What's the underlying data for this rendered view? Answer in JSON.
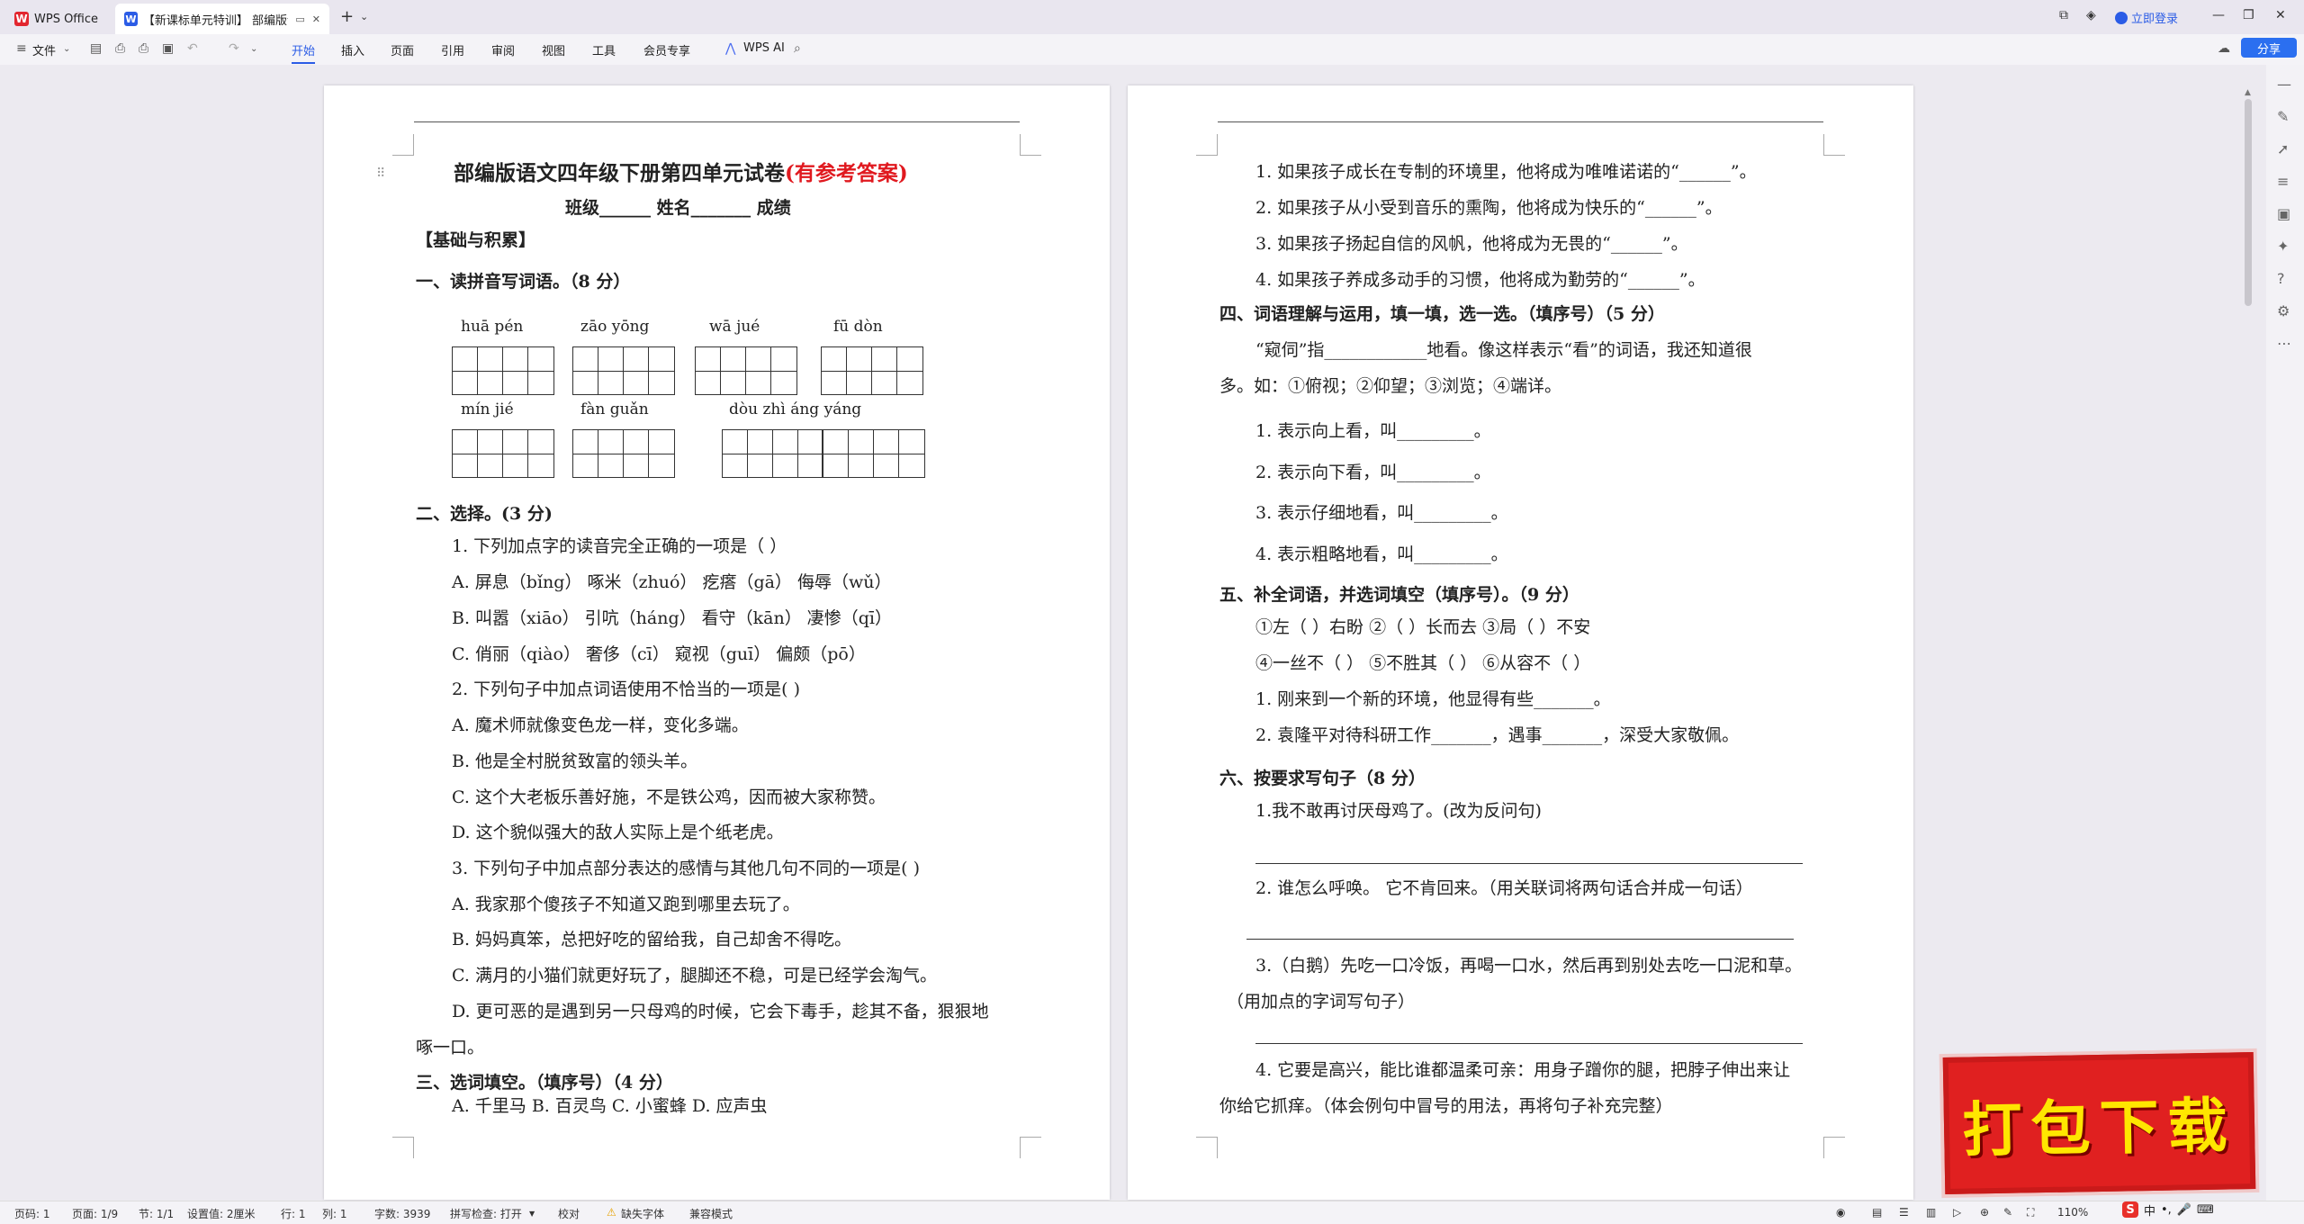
{
  "tabs": {
    "home_label": "WPS Office",
    "doc_label": "【新课标单元特训】 部编版语"
  },
  "topbar": {
    "login": "立即登录",
    "share": "分享"
  },
  "ribbon": {
    "file": "文件",
    "tabs": [
      "开始",
      "插入",
      "页面",
      "引用",
      "审阅",
      "视图",
      "工具",
      "会员专享"
    ],
    "ai": "WPS AI"
  },
  "page1": {
    "title": "部编版语文四年级下册第四单元试卷",
    "title_red": "(有参考答案)",
    "info": "班级______  姓名_______  成绩",
    "section_base": "【基础与积累】",
    "s1": "一、读拼音写词语。（8 分）",
    "pinyin_row1": [
      "huā  pén",
      "zāo  yōng",
      "wā  jué",
      "fū  dòn"
    ],
    "pinyin_row2": [
      "mín  jié",
      "fàn  guǎn",
      "dòu  zhì  áng  yáng"
    ],
    "s2": "二、选择。(3 分)",
    "q1": "1. 下列加点字的读音完全正确的一项是（     ）",
    "q1a": "A. 屏息（bǐng）    啄米（zhuó）    疙瘩（gā）     侮辱（wǔ）",
    "q1b": "B. 叫嚣（xiāo）    引吭（háng）    看守（kān）    凄惨（qī）",
    "q1c": "C. 俏丽（qiào）    奢侈（cī）      窥视（guī）    偏颇（pō）",
    "q2": "2. 下列句子中加点词语使用不恰当的一项是(     )",
    "q2a": "A. 魔术师就像变色龙一样，变化多端。",
    "q2b": "B. 他是全村脱贫致富的领头羊。",
    "q2c": "C. 这个大老板乐善好施，不是铁公鸡，因而被大家称赞。",
    "q2d": "D. 这个貌似强大的敌人实际上是个纸老虎。",
    "q3": "3. 下列句子中加点部分表达的感情与其他几句不同的一项是(     )",
    "q3a": "A. 我家那个傻孩子不知道又跑到哪里去玩了。",
    "q3b": "B. 妈妈真笨，总把好吃的留给我，自己却舍不得吃。",
    "q3c": "C. 满月的小猫们就更好玩了，腿脚还不稳，可是已经学会淘气。",
    "q3d": "D. 更可恶的是遇到另一只母鸡的时候，它会下毒手，趁其不备，狠狠地",
    "q3d2": "啄一口。",
    "s3": "三、选词填空。（填序号）（4 分）",
    "s3opts": "A. 千里马      B. 百灵鸟      C. 小蜜蜂      D. 应声虫"
  },
  "page2": {
    "p1": "1. 如果孩子成长在专制的环境里，他将成为唯唯诺诺的“______”。",
    "p2": "2. 如果孩子从小受到音乐的熏陶，他将成为快乐的“______”。",
    "p3": "3. 如果孩子扬起自信的风帆，他将成为无畏的“______”。",
    "p4": "4. 如果孩子养成多动手的习惯，他将成为勤劳的“______”。",
    "s4": "四、词语理解与运用，填一填，选一选。（填序号）（5 分）",
    "s4i1": "“窥伺”指____________地看。像这样表示“看”的词语，我还知道很",
    "s4i2": "多。如：①俯视；②仰望；③浏览；④端详。",
    "s4q1": "1. 表示向上看，叫_________。",
    "s4q2": "2. 表示向下看，叫_________。",
    "s4q3": "3. 表示仔细地看，叫_________。",
    "s4q4": "4. 表示粗略地看，叫_________。",
    "s5": "五、补全词语，并选词填空（填序号）。（9 分）",
    "s5r1": "①左（      ）右盼       ②（     ）长而去       ③局（      ）不安",
    "s5r2": "④一丝不（      ）       ⑤不胜其（      ）       ⑥从容不（      ）",
    "s5q1": "1. 刚来到一个新的环境，他显得有些_______。",
    "s5q2": "2. 袁隆平对待科研工作_______，遇事_______，深受大家敬佩。",
    "s6": "六、按要求写句子（8 分）",
    "s6q1": "1.我不敢再讨厌母鸡了。(改为反问句)",
    "s6q2": "2. 谁怎么呼唤。   它不肯回来。（用关联词将两句话合并成一句话）",
    "s6q3": "3.（白鹅）先吃一口冷饭，再喝一口水，然后再到别处去吃一口泥和草。",
    "s6q3b": "（用加点的字词写句子）",
    "s6q4": "4. 它要是高兴，能比谁都温柔可亲：用身子蹭你的腿，把脖子伸出来让",
    "s6q4b": "你给它抓痒。（体会例句中冒号的用法，再将句子补充完整）"
  },
  "status": {
    "page": "页码: 1",
    "pages": "页面: 1/9",
    "section": "节: 1/1",
    "setting": "设置值: 2厘米",
    "row": "行: 1",
    "col": "列: 1",
    "words": "字数: 3939",
    "spell": "拼写检查: 打开",
    "proof": "校对",
    "missing_font": "缺失字体",
    "compat": "兼容模式",
    "zoom": "110%"
  },
  "banner": {
    "text": "打包下载"
  },
  "ime": {
    "lang": "中"
  }
}
